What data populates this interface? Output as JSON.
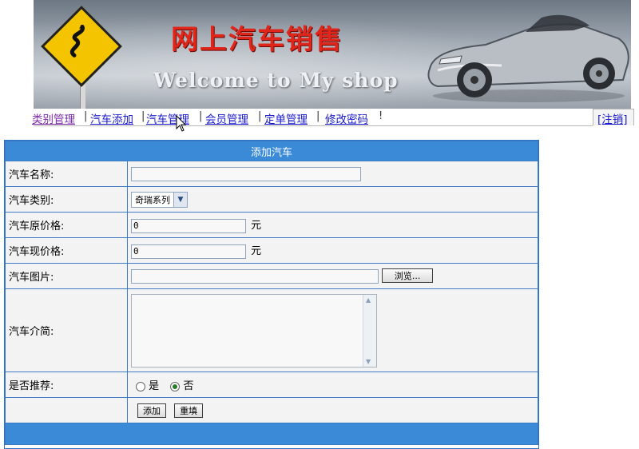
{
  "banner": {
    "title": "网上汽车销售",
    "welcome": "Welcome to My shop"
  },
  "nav": {
    "items": [
      "类别管理",
      "汽车添加",
      "汽车管理",
      "会员管理",
      "定单管理",
      "修改密码"
    ],
    "separator": "|",
    "end_mark": "!",
    "logout": "[注销]"
  },
  "form": {
    "header": "添加汽车",
    "fields": {
      "name": {
        "label": "汽车名称:",
        "value": ""
      },
      "category": {
        "label": "汽车类别:",
        "selected": "奇瑞系列"
      },
      "orig_price": {
        "label": "汽车原价格:",
        "value": "0",
        "unit": "元"
      },
      "cur_price": {
        "label": "汽车现价格:",
        "value": "0",
        "unit": "元"
      },
      "image": {
        "label": "汽车图片:",
        "value": "",
        "browse": "浏览..."
      },
      "intro": {
        "label": "汽车介简:",
        "value": ""
      },
      "recommend": {
        "label": "是否推荐:",
        "yes": "是",
        "no": "否",
        "selected": "否"
      }
    },
    "buttons": {
      "add": "添加",
      "reset": "重填"
    }
  },
  "colors": {
    "header_blue": "#3a8ad8",
    "border_blue": "#3c7ac2",
    "link_blue": "#1a1acc",
    "banner_title_red": "#e0261b"
  }
}
